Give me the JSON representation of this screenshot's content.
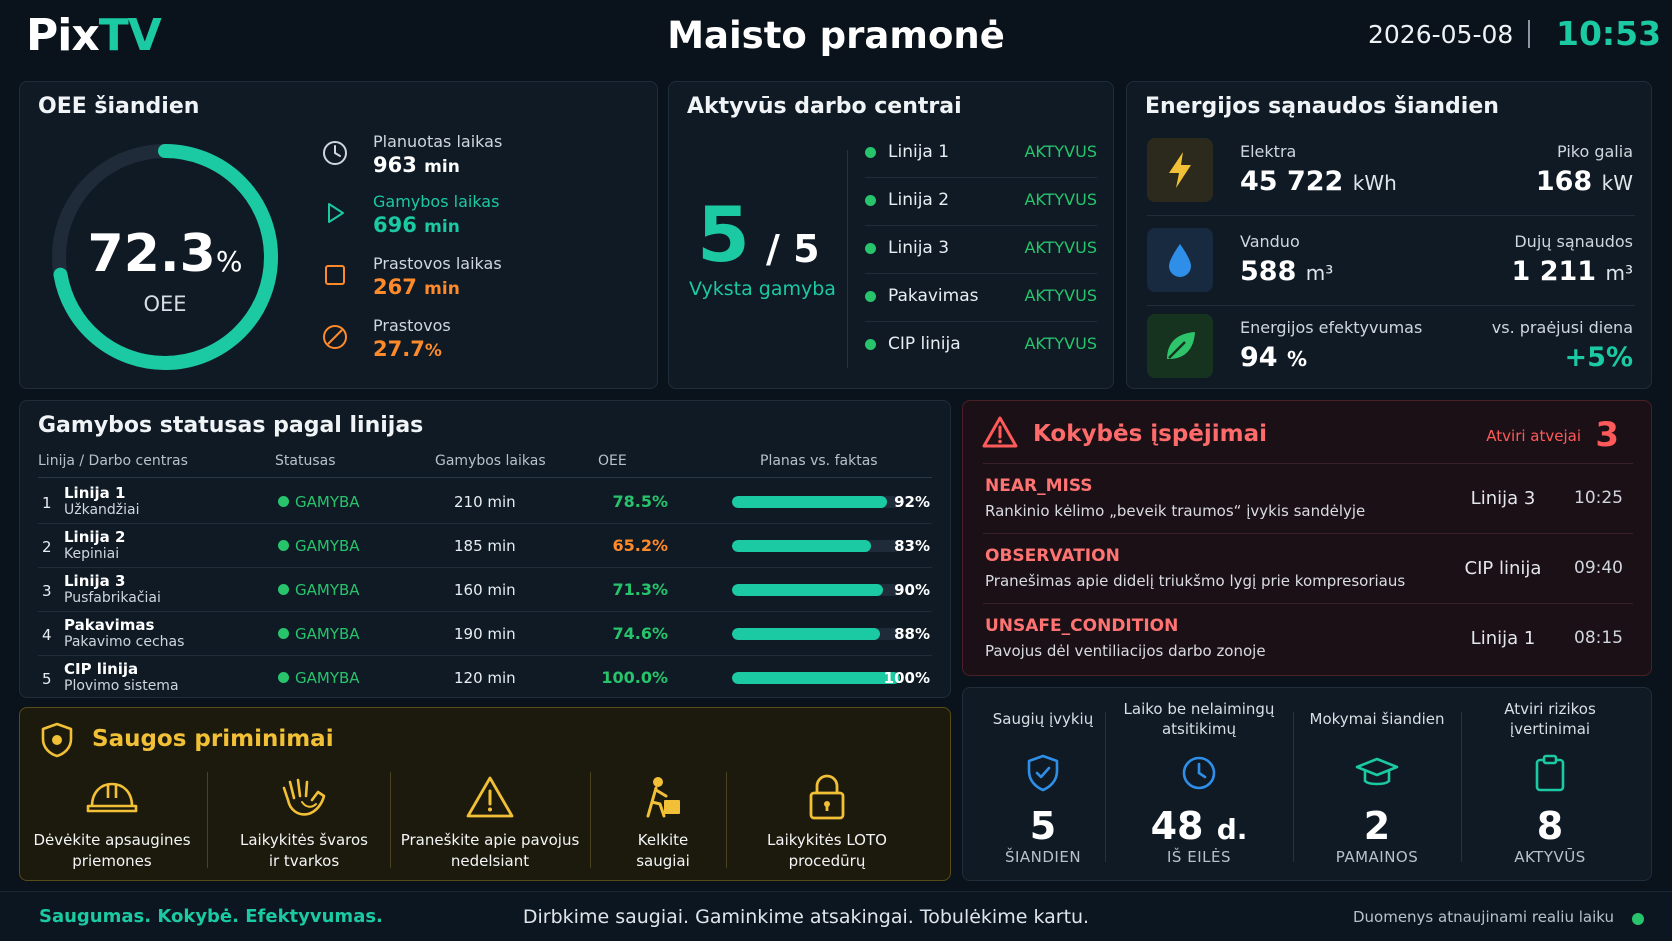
{
  "header": {
    "logo_part1": "Pix",
    "logo_part2": "TV",
    "title": "Maisto pramonė",
    "date": "2026-05-08",
    "time": "10:53"
  },
  "oee": {
    "title": "OEE šiandien",
    "value": "72.3",
    "value_unit": "%",
    "value_fraction": 0.723,
    "label": "OEE",
    "metrics": [
      {
        "label": "Planuotas laikas",
        "value": "963",
        "unit": "min",
        "color": "#ffffff",
        "icon": "clock-icon"
      },
      {
        "label": "Gamybos laikas",
        "value": "696",
        "unit": "min",
        "color": "#1bc9a3",
        "icon": "play-icon"
      },
      {
        "label": "Prastovos laikas",
        "value": "267",
        "unit": "min",
        "color": "#ff8a2a",
        "icon": "stop-icon"
      },
      {
        "label": "Prastovos",
        "value": "27.7",
        "unit": "%",
        "color": "#ff8a2a",
        "icon": "ban-icon"
      }
    ]
  },
  "active": {
    "title": "Aktyvūs darbo centrai",
    "count": "5",
    "total": "/ 5",
    "subtitle": "Vyksta gamyba",
    "items": [
      {
        "name": "Linija 1",
        "status": "AKTYVUS"
      },
      {
        "name": "Linija 2",
        "status": "AKTYVUS"
      },
      {
        "name": "Linija 3",
        "status": "AKTYVUS"
      },
      {
        "name": "Pakavimas",
        "status": "AKTYVUS"
      },
      {
        "name": "CIP linija",
        "status": "AKTYVUS"
      }
    ]
  },
  "energy": {
    "title": "Energijos sąnaudos šiandien",
    "rows": [
      {
        "icon": "lightning-icon",
        "label": "Elektra",
        "value": "45 722",
        "unit": "kWh",
        "rlabel": "Piko galia",
        "rvalue": "168",
        "runit": "kW",
        "rcolor": "#ffffff"
      },
      {
        "icon": "water-drop-icon",
        "label": "Vanduo",
        "value": "588",
        "unit": "m³",
        "rlabel": "Dujų sąnaudos",
        "rvalue": "1 211",
        "runit": "m³",
        "rcolor": "#ffffff"
      },
      {
        "icon": "leaf-icon",
        "label": "Energijos efektyvumas",
        "value": "94",
        "unit": "%",
        "rlabel": "vs. praėjusi diena",
        "rvalue": "+5%",
        "runit": "",
        "rcolor": "#1bc9a3"
      }
    ]
  },
  "production": {
    "title": "Gamybos statusas pagal linijas",
    "columns": [
      "Linija / Darbo centras",
      "Statusas",
      "Gamybos laikas",
      "OEE",
      "Planas vs. faktas"
    ],
    "rows": [
      {
        "idx": "1",
        "line": "Linija 1",
        "sub": "Užkandžiai",
        "status": "GAMYBA",
        "time": "210 min",
        "oee": "78.5%",
        "oee_color": "#27c46c",
        "plan": "92%",
        "plan_fraction": 0.92
      },
      {
        "idx": "2",
        "line": "Linija 2",
        "sub": "Kepiniai",
        "status": "GAMYBA",
        "time": "185 min",
        "oee": "65.2%",
        "oee_color": "#ff8a2a",
        "plan": "83%",
        "plan_fraction": 0.83
      },
      {
        "idx": "3",
        "line": "Linija 3",
        "sub": "Pusfabrikačiai",
        "status": "GAMYBA",
        "time": "160 min",
        "oee": "71.3%",
        "oee_color": "#27c46c",
        "plan": "90%",
        "plan_fraction": 0.9
      },
      {
        "idx": "4",
        "line": "Pakavimas",
        "sub": "Pakavimo cechas",
        "status": "GAMYBA",
        "time": "190 min",
        "oee": "74.6%",
        "oee_color": "#27c46c",
        "plan": "88%",
        "plan_fraction": 0.88
      },
      {
        "idx": "5",
        "line": "CIP linija",
        "sub": "Plovimo sistema",
        "status": "GAMYBA",
        "time": "120 min",
        "oee": "100.0%",
        "oee_color": "#27c46c",
        "plan": "100%",
        "plan_fraction": 1.0
      }
    ]
  },
  "quality": {
    "title": "Kokybės įspėjimai",
    "open_label": "Atviri atvejai",
    "open_count": "3",
    "items": [
      {
        "code": "NEAR_MISS",
        "desc": "Rankinio kėlimo „beveik traumos“ įvykis sandėlyje",
        "where": "Linija 3",
        "time": "10:25"
      },
      {
        "code": "OBSERVATION",
        "desc": "Pranešimas apie didelį triukšmo lygį prie kompresoriaus",
        "where": "CIP linija",
        "time": "09:40"
      },
      {
        "code": "UNSAFE_CONDITION",
        "desc": "Pavojus dėl ventiliacijos darbo zonoje",
        "where": "Linija 1",
        "time": "08:15"
      }
    ]
  },
  "safety": {
    "title": "Saugos priminimai",
    "items": [
      {
        "icon": "hard-hat-icon",
        "line1": "Dėvėkite apsaugines",
        "line2": "priemones"
      },
      {
        "icon": "hands-icon",
        "line1": "Laikykitės švaros",
        "line2": "ir tvarkos"
      },
      {
        "icon": "warning-icon",
        "line1": "Praneškite apie pavojus",
        "line2": "nedelsiant"
      },
      {
        "icon": "lifting-icon",
        "line1": "Kelkite",
        "line2": "saugiai"
      },
      {
        "icon": "lock-icon",
        "line1": "Laikykitės LOTO",
        "line2": "procedūrų"
      }
    ]
  },
  "stats": [
    {
      "icon": "shield-check-icon",
      "label": "Saugių įvykių",
      "value": "5",
      "unit": "",
      "sub": "ŠIANDIEN"
    },
    {
      "icon": "clock-icon",
      "label": "Laiko be nelaimingų atsitikimų",
      "value": "48",
      "unit": "d.",
      "sub": "IŠ EILĖS"
    },
    {
      "icon": "graduation-cap-icon",
      "label": "Mokymai šiandien",
      "value": "2",
      "unit": "",
      "sub": "PAMAINOS"
    },
    {
      "icon": "clipboard-icon",
      "label": "Atviri rizikos įvertinimai",
      "value": "8",
      "unit": "",
      "sub": "AKTYVŪS"
    }
  ],
  "footer": {
    "left": "Saugumas. Kokybė. Efektyvumas.",
    "middle": "Dirbkime saugiai. Gaminkime atsakingai. Tobulėkime kartu.",
    "right": "Duomenys atnaujinami realiu laiku"
  },
  "colors": {
    "accent": "#1bc9a3",
    "ok": "#27c46c",
    "warn": "#ff8a2a",
    "alert": "#ff5a5a",
    "safety": "#f2c037"
  }
}
